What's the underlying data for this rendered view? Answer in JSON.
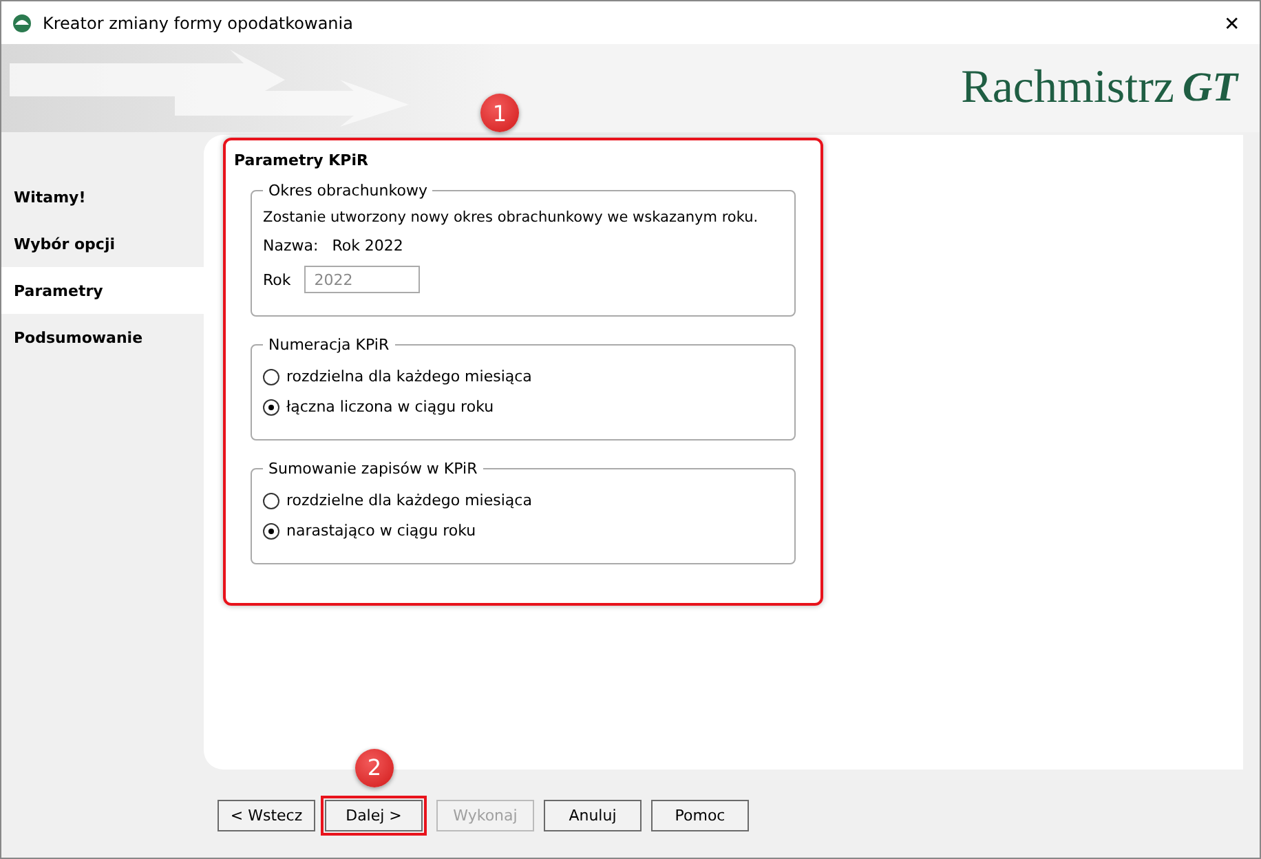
{
  "window": {
    "title": "Kreator zmiany formy opodatkowania",
    "close": "✕"
  },
  "banner": {
    "logo_text": "Rachmistrz",
    "logo_mark": "GT"
  },
  "sidebar": {
    "items": [
      {
        "label": "Witamy!",
        "selected": false
      },
      {
        "label": "Wybór opcji",
        "selected": false
      },
      {
        "label": "Parametry",
        "selected": true
      },
      {
        "label": "Podsumowanie",
        "selected": false
      }
    ]
  },
  "panel": {
    "annotation": "1",
    "title": "Parametry KPiR",
    "period_group": {
      "legend": "Okres obrachunkowy",
      "info": "Zostanie utworzony nowy okres obrachunkowy we wskazanym roku.",
      "name_label": "Nazwa:",
      "name_value": "Rok 2022",
      "year_label": "Rok",
      "year_value": "2022",
      "year_disabled": true
    },
    "radio_groups": [
      {
        "legend": "Numeracja KPiR",
        "options": [
          {
            "label": "rozdzielna dla każdego miesiąca",
            "selected": false
          },
          {
            "label": "łączna liczona w ciągu roku",
            "selected": true
          }
        ]
      },
      {
        "legend": "Sumowanie zapisów w KPiR",
        "options": [
          {
            "label": "rozdzielne dla każdego miesiąca",
            "selected": false
          },
          {
            "label": "narastająco w ciągu roku",
            "selected": true
          }
        ]
      }
    ]
  },
  "buttons": [
    {
      "label": "< Wstecz",
      "disabled": false
    },
    {
      "label": "Dalej >",
      "disabled": false,
      "annotation": "2"
    },
    {
      "label": "Wykonaj",
      "disabled": true
    },
    {
      "label": "Anuluj",
      "disabled": false
    },
    {
      "label": "Pomoc",
      "disabled": false
    }
  ]
}
